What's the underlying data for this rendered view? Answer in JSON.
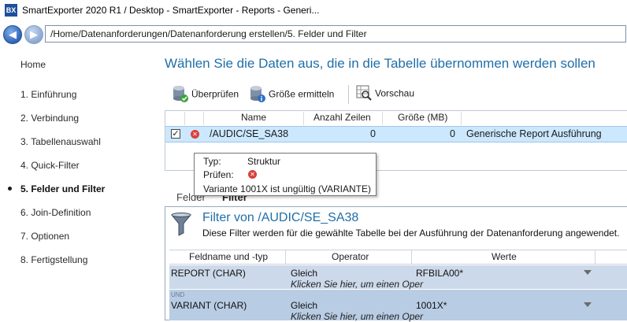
{
  "window": {
    "logo_text": "BX",
    "title": "SmartExporter 2020 R1 / Desktop - SmartExporter - Reports - Generi..."
  },
  "nav": {
    "back_symbol": "◀",
    "forward_symbol": "▶",
    "breadcrumb": "/Home/Datenanforderungen/Datenanforderung erstellen/5. Felder und Filter"
  },
  "sidebar": {
    "items": [
      {
        "label": "Home"
      },
      {
        "label": "1. Einführung"
      },
      {
        "label": "2. Verbindung"
      },
      {
        "label": "3. Tabellenauswahl"
      },
      {
        "label": "4. Quick-Filter"
      },
      {
        "label": "5. Felder und Filter",
        "active": true
      },
      {
        "label": "6. Join-Definition"
      },
      {
        "label": "7. Optionen"
      },
      {
        "label": "8. Fertigstellung"
      }
    ]
  },
  "main": {
    "heading": "Wählen Sie die Daten aus, die in die Tabelle übernommen werden sollen",
    "toolbar": {
      "check_label": "Überprüfen",
      "size_label": "Größe ermitteln",
      "preview_label": "Vorschau"
    },
    "table": {
      "columns": [
        "Name",
        "Anzahl Zeilen",
        "Größe (MB)"
      ],
      "rows": [
        {
          "checked": true,
          "status": "error",
          "name": "/AUDIC/SE_SA38",
          "rows": "0",
          "size": "0",
          "description": "Generische Report Ausführung"
        }
      ]
    },
    "tooltip": {
      "type_label": "Typ:",
      "type_value": "Struktur",
      "check_label": "Prüfen:",
      "message": "Variante 1001X ist ungültig (VARIANTE)"
    },
    "tabs": [
      {
        "label": "Felder"
      },
      {
        "label": "Filter",
        "active": true
      }
    ],
    "filter": {
      "title": "Filter von /AUDIC/SE_SA38",
      "description": "Diese Filter werden für die gewählte Tabelle bei der Ausführung der Datenanforderung angewendet.",
      "columns": [
        "Feldname und -typ",
        "Operator",
        "Werte"
      ],
      "rows": [
        {
          "connector": "",
          "field": "REPORT   (CHAR)",
          "operator": "Gleich",
          "hint": "Klicken Sie hier, um einen Oper",
          "value": "RFBILA00*"
        },
        {
          "connector": "UND",
          "field": "VARIANT   (CHAR)",
          "operator": "Gleich",
          "hint": "Klicken Sie hier, um einen Oper",
          "value": "1001X*"
        }
      ]
    }
  },
  "colors": {
    "heading_blue": "#1f6ea8",
    "row_selected": "#cce8ff",
    "filter_row_1": "#ccd9ea",
    "filter_row_2": "#b8cce4",
    "error_red": "#d9413a"
  }
}
